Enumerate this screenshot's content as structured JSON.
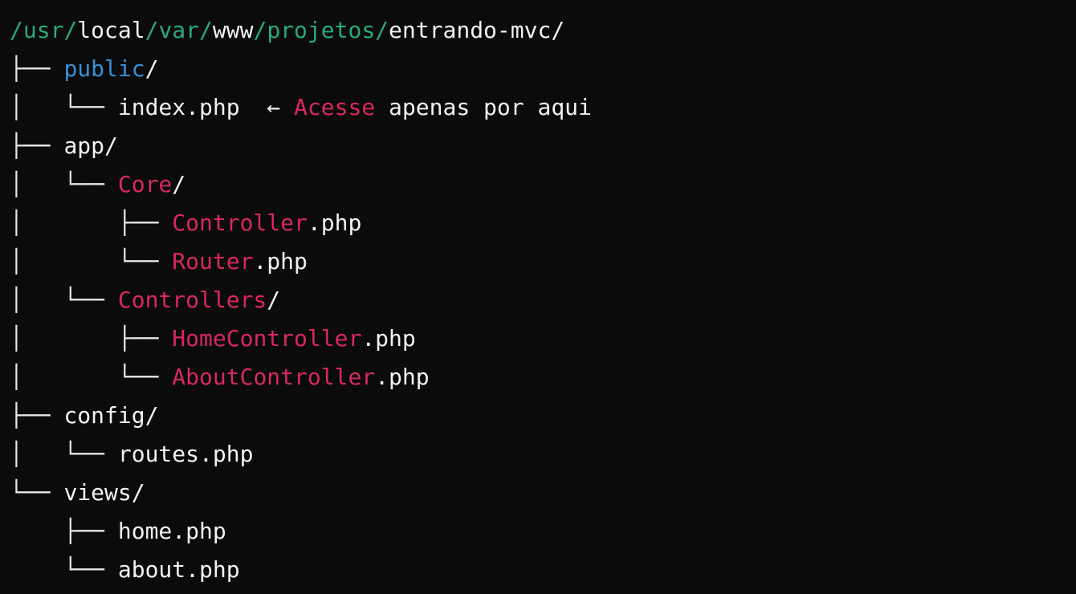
{
  "colors": {
    "background": "#0b0b0b",
    "text": "#f2f2f2",
    "path_green": "#2aa87e",
    "folder_blue": "#3a8fd6",
    "accent_pink": "#d8285f"
  },
  "tree": {
    "lines": [
      {
        "kind": "root-path",
        "segments": [
          {
            "text": "/usr/",
            "color": "green"
          },
          {
            "text": "local",
            "color": "white"
          },
          {
            "text": "/var/",
            "color": "green"
          },
          {
            "text": "www",
            "color": "white"
          },
          {
            "text": "/projetos/",
            "color": "green"
          },
          {
            "text": "entrando-mvc/",
            "color": "white"
          }
        ]
      },
      {
        "kind": "folder",
        "segments": [
          {
            "text": "├── ",
            "color": "tree"
          },
          {
            "text": "public",
            "color": "blue"
          },
          {
            "text": "/",
            "color": "white"
          }
        ]
      },
      {
        "kind": "file",
        "segments": [
          {
            "text": "│   └── ",
            "color": "tree"
          },
          {
            "text": "index.php",
            "color": "white"
          },
          {
            "text": "  ← ",
            "color": "white"
          },
          {
            "text": "Acesse",
            "color": "pink"
          },
          {
            "text": " apenas por aqui",
            "color": "white"
          }
        ]
      },
      {
        "kind": "folder",
        "segments": [
          {
            "text": "├── ",
            "color": "tree"
          },
          {
            "text": "app/",
            "color": "white"
          }
        ]
      },
      {
        "kind": "folder",
        "segments": [
          {
            "text": "│   └── ",
            "color": "tree"
          },
          {
            "text": "Core",
            "color": "pink"
          },
          {
            "text": "/",
            "color": "white"
          }
        ]
      },
      {
        "kind": "file",
        "segments": [
          {
            "text": "│       ├── ",
            "color": "tree"
          },
          {
            "text": "Controller",
            "color": "pink"
          },
          {
            "text": ".php",
            "color": "white"
          }
        ]
      },
      {
        "kind": "file",
        "segments": [
          {
            "text": "│       └── ",
            "color": "tree"
          },
          {
            "text": "Router",
            "color": "pink"
          },
          {
            "text": ".php",
            "color": "white"
          }
        ]
      },
      {
        "kind": "folder",
        "segments": [
          {
            "text": "│   └── ",
            "color": "tree"
          },
          {
            "text": "Controllers",
            "color": "pink"
          },
          {
            "text": "/",
            "color": "white"
          }
        ]
      },
      {
        "kind": "file",
        "segments": [
          {
            "text": "│       ├── ",
            "color": "tree"
          },
          {
            "text": "HomeController",
            "color": "pink"
          },
          {
            "text": ".php",
            "color": "white"
          }
        ]
      },
      {
        "kind": "file",
        "segments": [
          {
            "text": "│       └── ",
            "color": "tree"
          },
          {
            "text": "AboutController",
            "color": "pink"
          },
          {
            "text": ".php",
            "color": "white"
          }
        ]
      },
      {
        "kind": "folder",
        "segments": [
          {
            "text": "├── ",
            "color": "tree"
          },
          {
            "text": "config/",
            "color": "white"
          }
        ]
      },
      {
        "kind": "file",
        "segments": [
          {
            "text": "│   └── ",
            "color": "tree"
          },
          {
            "text": "routes.php",
            "color": "white"
          }
        ]
      },
      {
        "kind": "folder",
        "segments": [
          {
            "text": "└── ",
            "color": "tree"
          },
          {
            "text": "views/",
            "color": "white"
          }
        ]
      },
      {
        "kind": "file",
        "segments": [
          {
            "text": "    ├── ",
            "color": "tree"
          },
          {
            "text": "home.php",
            "color": "white"
          }
        ]
      },
      {
        "kind": "file",
        "segments": [
          {
            "text": "    └── ",
            "color": "tree"
          },
          {
            "text": "about.php",
            "color": "white"
          }
        ]
      }
    ]
  }
}
